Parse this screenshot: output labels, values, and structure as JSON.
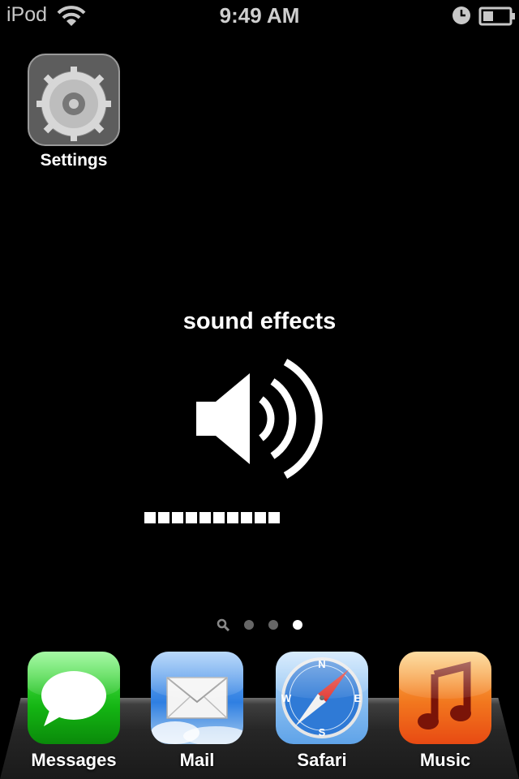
{
  "status_bar": {
    "carrier": "iPod",
    "time": "9:49 AM"
  },
  "home_apps": [
    {
      "label": "Settings",
      "icon": "gear-icon"
    }
  ],
  "hud": {
    "title": "sound effects",
    "icon": "speaker-icon",
    "level_segments": 10,
    "filled_segments": 10
  },
  "page_indicator": {
    "pages": 3,
    "current_page": 3,
    "has_spotlight": true
  },
  "dock": [
    {
      "label": "Messages",
      "icon": "messages-icon"
    },
    {
      "label": "Mail",
      "icon": "mail-icon"
    },
    {
      "label": "Safari",
      "icon": "safari-icon"
    },
    {
      "label": "Music",
      "icon": "music-icon"
    }
  ],
  "colors": {
    "background": "#000000",
    "active_dot": "#ffffff",
    "inactive_dot": "#666666"
  }
}
